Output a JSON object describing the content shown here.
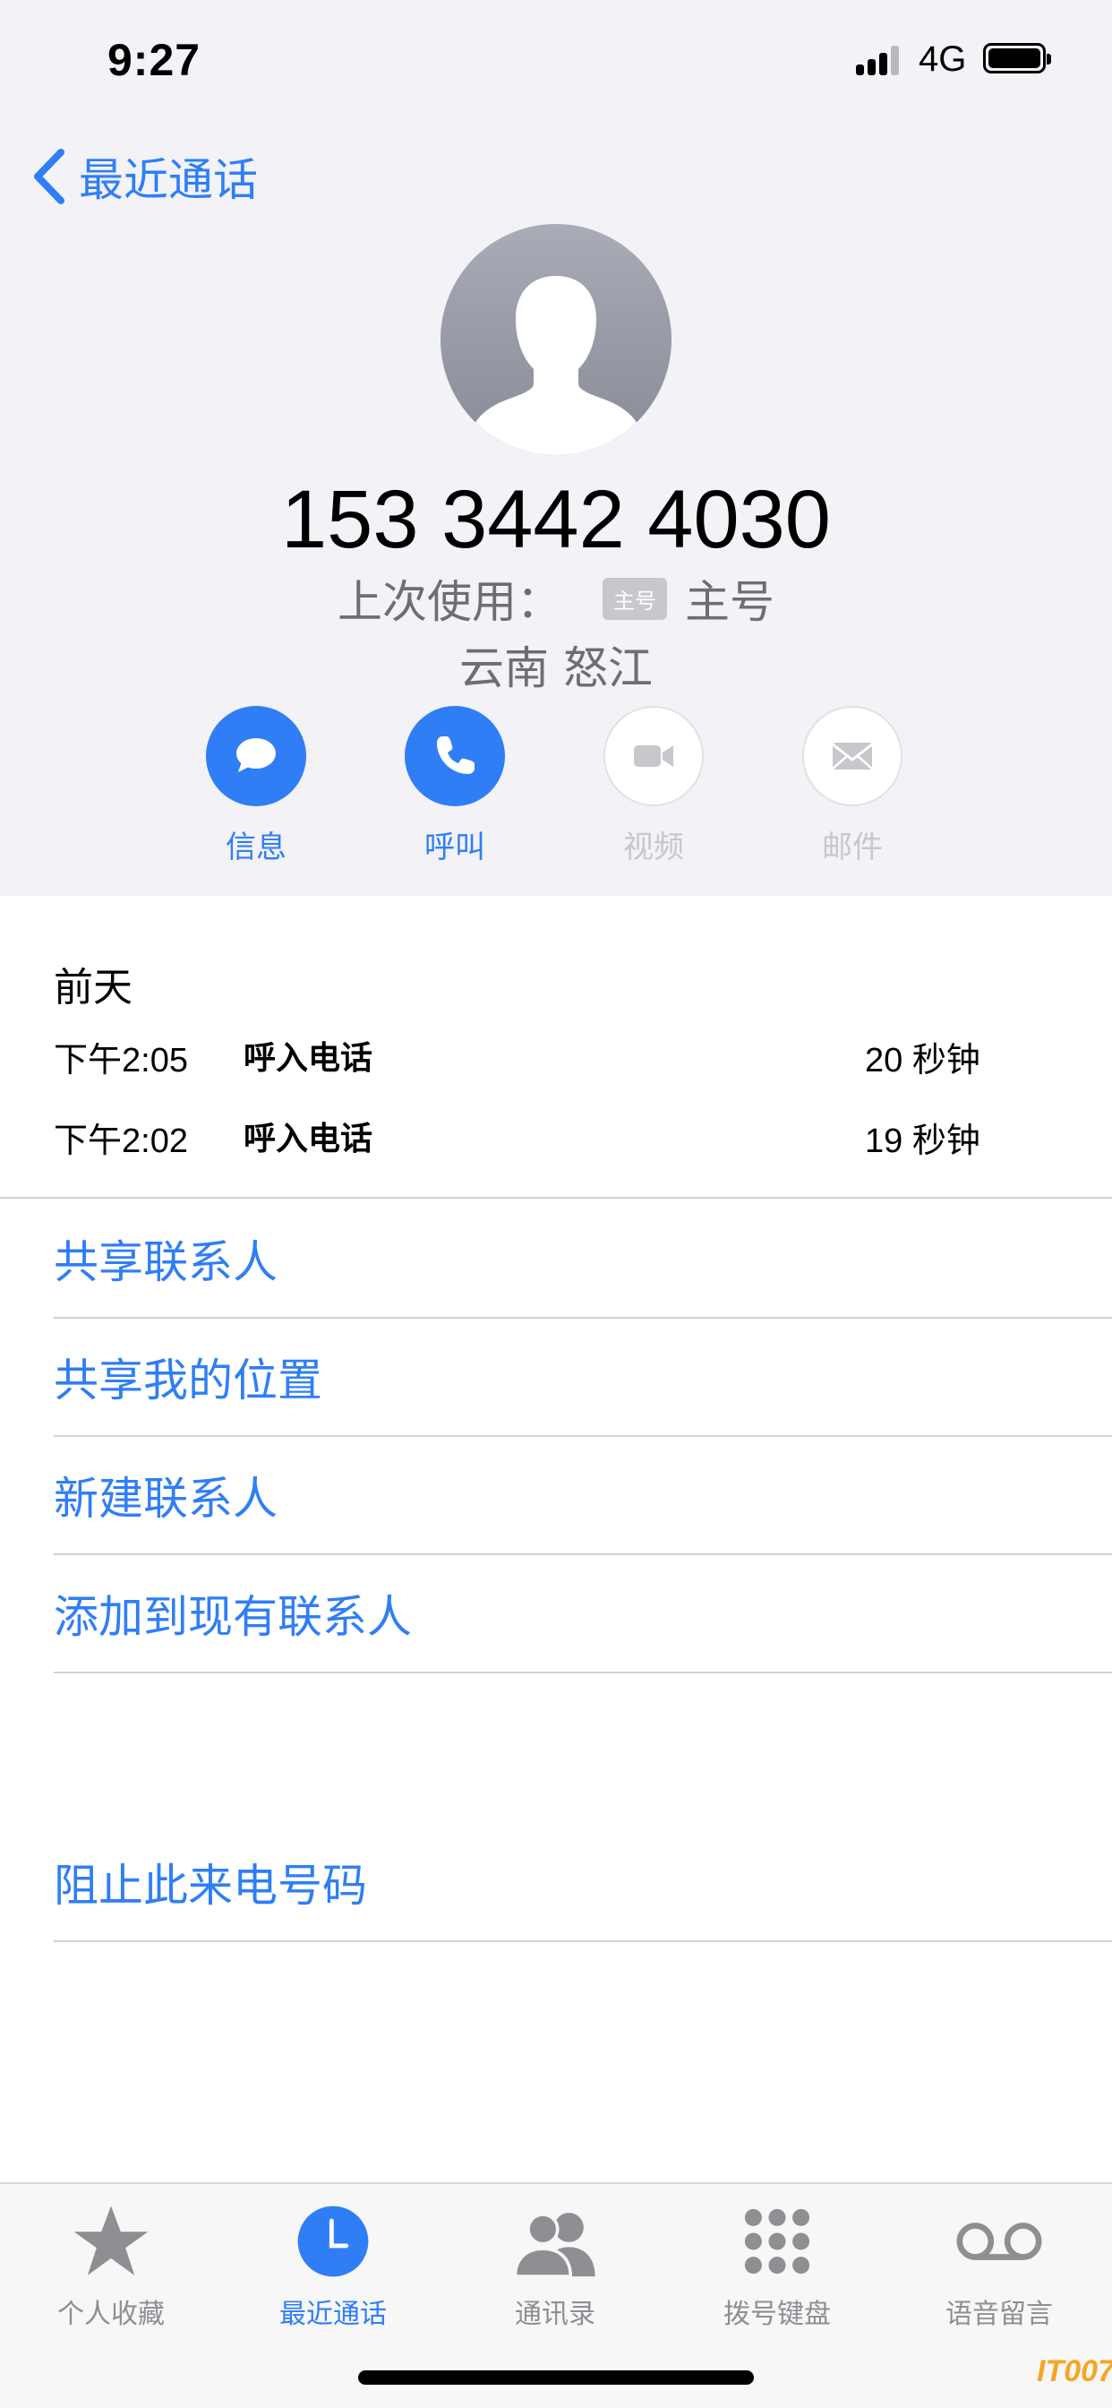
{
  "status_bar": {
    "time": "9:27",
    "network": "4G"
  },
  "nav": {
    "back_label": "最近通话"
  },
  "contact": {
    "phone_number": "153 3442 4030",
    "last_used_prefix": "上次使用：",
    "sim_badge": "主号",
    "sim_name": "主号",
    "location": "云南 怒江"
  },
  "actions": [
    {
      "label": "信息",
      "icon": "message-bubble-icon",
      "enabled": true
    },
    {
      "label": "呼叫",
      "icon": "phone-icon",
      "enabled": true
    },
    {
      "label": "视频",
      "icon": "video-camera-icon",
      "enabled": false
    },
    {
      "label": "邮件",
      "icon": "envelope-icon",
      "enabled": false
    }
  ],
  "history": {
    "date": "前天",
    "calls": [
      {
        "time": "下午2:05",
        "type": "呼入电话",
        "duration": "20 秒钟"
      },
      {
        "time": "下午2:02",
        "type": "呼入电话",
        "duration": "19 秒钟"
      }
    ]
  },
  "options": {
    "share_contact": "共享联系人",
    "share_location": "共享我的位置",
    "new_contact": "新建联系人",
    "add_to_existing": "添加到现有联系人",
    "block_caller": "阻止此来电号码"
  },
  "tabs": [
    {
      "label": "个人收藏",
      "icon": "star-icon",
      "active": false
    },
    {
      "label": "最近通话",
      "icon": "clock-icon",
      "active": true
    },
    {
      "label": "通讯录",
      "icon": "contacts-icon",
      "active": false
    },
    {
      "label": "拨号键盘",
      "icon": "keypad-icon",
      "active": false
    },
    {
      "label": "语音留言",
      "icon": "voicemail-icon",
      "active": false
    }
  ],
  "colors": {
    "accent": "#2f7ef6",
    "header_background": "#f2f2f7",
    "secondary_text": "#6d6d72",
    "disabled": "#c7c7cc"
  },
  "watermark": "IT007"
}
